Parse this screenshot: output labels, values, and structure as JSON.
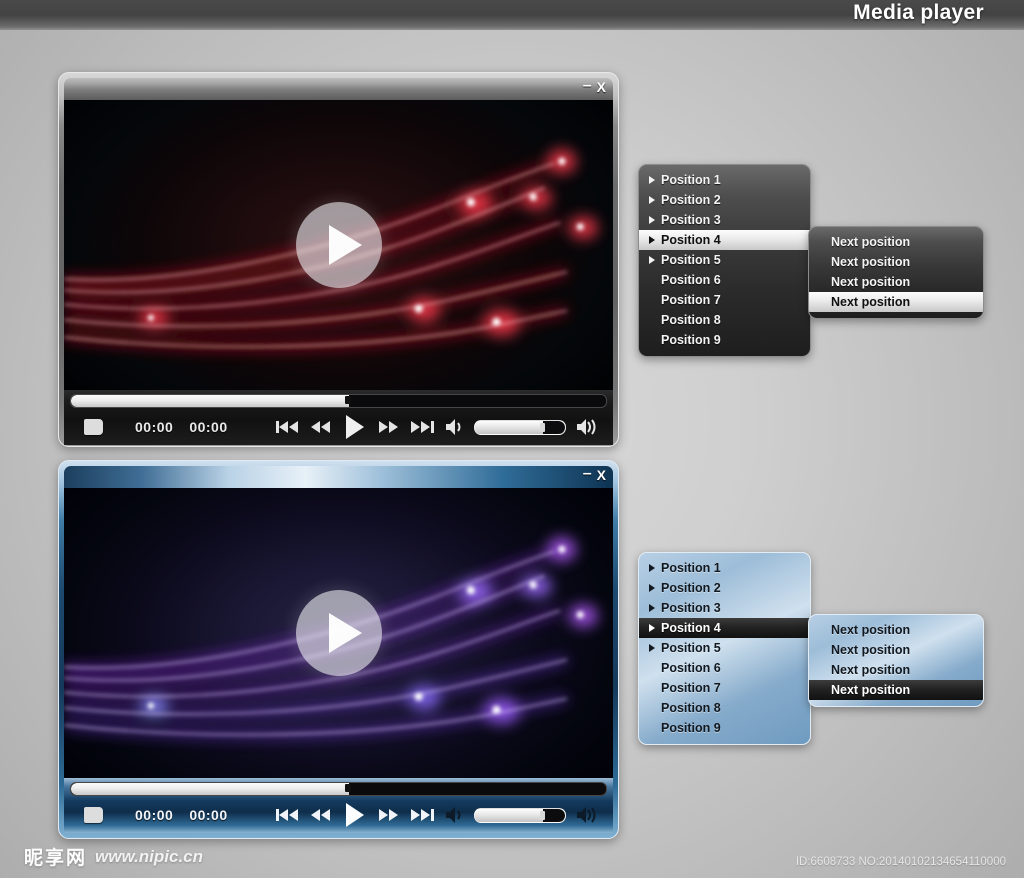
{
  "header": {
    "title": "Media player"
  },
  "players": [
    {
      "theme": "dark",
      "window_controls": {
        "minimize": "–",
        "close": "X"
      },
      "progress": {
        "percent": 52
      },
      "times": {
        "elapsed": "00:00",
        "total": "00:00"
      },
      "buttons": {
        "stop": "stop-button",
        "prev": "previous-track-button",
        "rewind": "rewind-button",
        "play": "play-button",
        "forward": "fast-forward-button",
        "next": "next-track-button",
        "mute": "volume-low-icon",
        "max": "volume-high-icon"
      },
      "volume": {
        "percent": 74
      }
    },
    {
      "theme": "blue",
      "window_controls": {
        "minimize": "–",
        "close": "X"
      },
      "progress": {
        "percent": 52
      },
      "times": {
        "elapsed": "00:00",
        "total": "00:00"
      },
      "buttons": {
        "stop": "stop-button",
        "prev": "previous-track-button",
        "rewind": "rewind-button",
        "play": "play-button",
        "forward": "fast-forward-button",
        "next": "next-track-button",
        "mute": "volume-low-icon",
        "max": "volume-high-icon"
      },
      "volume": {
        "percent": 74
      }
    }
  ],
  "menus": [
    {
      "theme": "dark",
      "items": [
        {
          "label": "Position 1",
          "has_submenu_arrow": true,
          "selected": false
        },
        {
          "label": "Position 2",
          "has_submenu_arrow": true,
          "selected": false
        },
        {
          "label": "Position 3",
          "has_submenu_arrow": true,
          "selected": false
        },
        {
          "label": "Position 4",
          "has_submenu_arrow": true,
          "selected": true
        },
        {
          "label": "Position 5",
          "has_submenu_arrow": true,
          "selected": false
        },
        {
          "label": "Position 6",
          "has_submenu_arrow": false,
          "selected": false
        },
        {
          "label": "Position 7",
          "has_submenu_arrow": false,
          "selected": false
        },
        {
          "label": "Position 8",
          "has_submenu_arrow": false,
          "selected": false
        },
        {
          "label": "Position 9",
          "has_submenu_arrow": false,
          "selected": false
        }
      ],
      "submenu": {
        "items": [
          {
            "label": "Next position",
            "selected": false
          },
          {
            "label": "Next position",
            "selected": false
          },
          {
            "label": "Next position",
            "selected": false
          },
          {
            "label": "Next position",
            "selected": true
          }
        ]
      }
    },
    {
      "theme": "blue",
      "items": [
        {
          "label": "Position 1",
          "has_submenu_arrow": true,
          "selected": false
        },
        {
          "label": "Position 2",
          "has_submenu_arrow": true,
          "selected": false
        },
        {
          "label": "Position 3",
          "has_submenu_arrow": true,
          "selected": false
        },
        {
          "label": "Position 4",
          "has_submenu_arrow": true,
          "selected": true
        },
        {
          "label": "Position 5",
          "has_submenu_arrow": true,
          "selected": false
        },
        {
          "label": "Position 6",
          "has_submenu_arrow": false,
          "selected": false
        },
        {
          "label": "Position 7",
          "has_submenu_arrow": false,
          "selected": false
        },
        {
          "label": "Position 8",
          "has_submenu_arrow": false,
          "selected": false
        },
        {
          "label": "Position 9",
          "has_submenu_arrow": false,
          "selected": false
        }
      ],
      "submenu": {
        "items": [
          {
            "label": "Next position",
            "selected": false
          },
          {
            "label": "Next position",
            "selected": false
          },
          {
            "label": "Next position",
            "selected": false
          },
          {
            "label": "Next position",
            "selected": true
          }
        ]
      }
    }
  ],
  "footer": {
    "watermark_cn": "昵享网",
    "watermark_url": "www.nipic.cn",
    "id_tag": "ID:6608733 NO:20140102134654110000"
  },
  "colors": {
    "accent_red": "#e8122a",
    "accent_purple": "#8a3cd8",
    "header_band": "#464646",
    "menu_highlight_light": "#ededed",
    "menu_highlight_dark": "#1a1a1a"
  }
}
